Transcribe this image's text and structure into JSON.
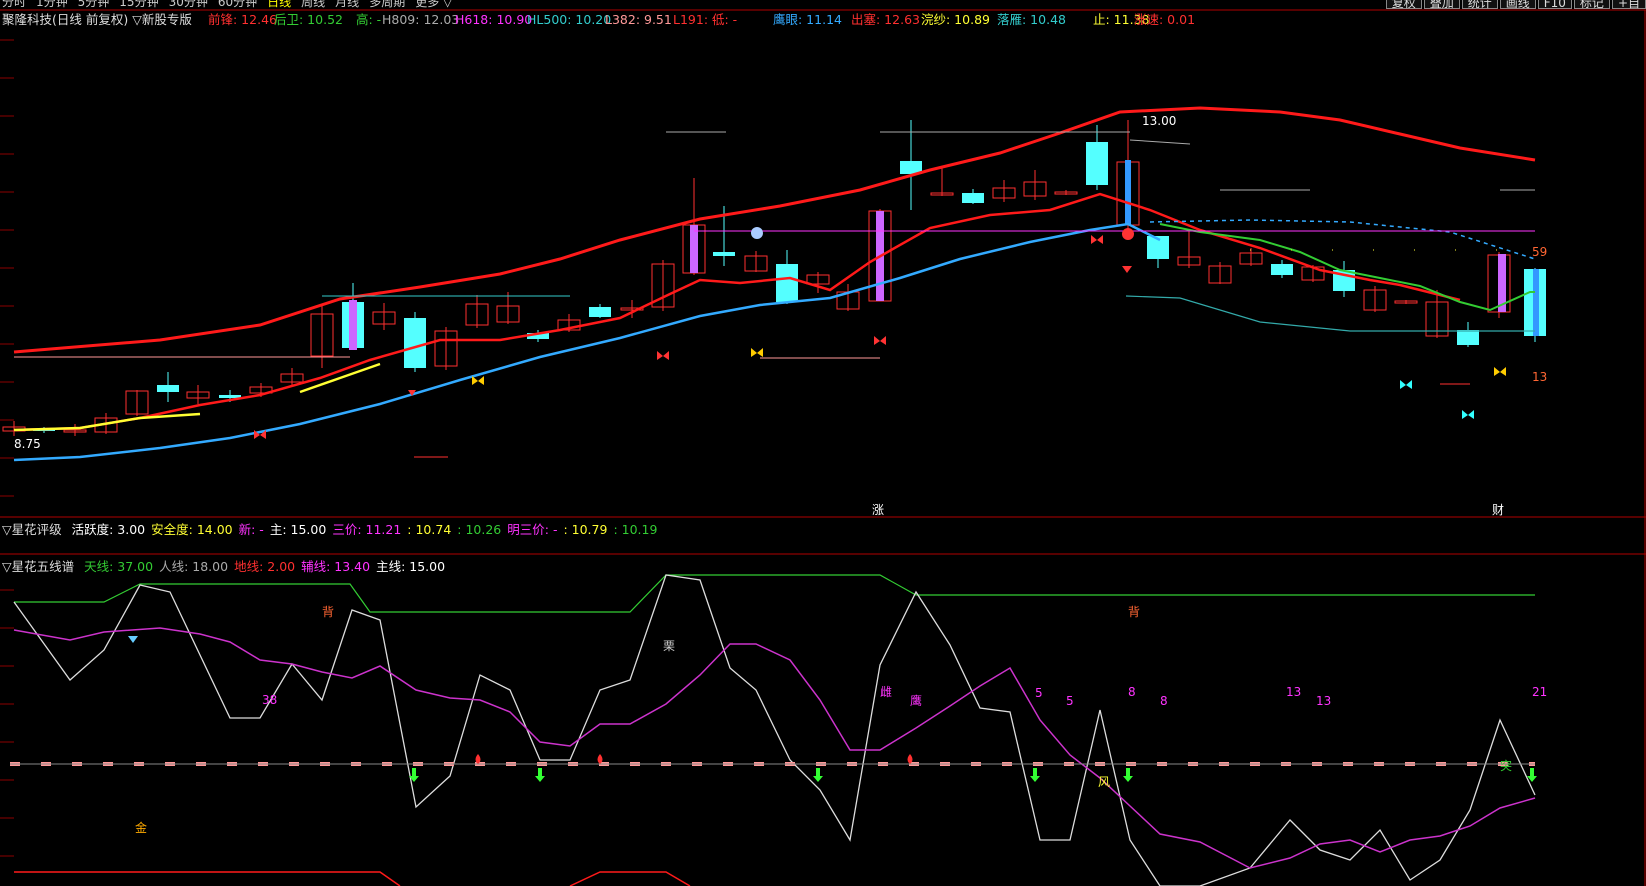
{
  "toolbar": {
    "periods": [
      "分时",
      "1分钟",
      "5分钟",
      "15分钟",
      "30分钟",
      "60分钟",
      "日线",
      "周线",
      "月线",
      "多周期",
      "更多 ▽"
    ],
    "active_period": "日线",
    "buttons": [
      "复权",
      "叠加",
      "统计",
      "画线",
      "F10",
      "标记",
      "+自"
    ]
  },
  "stock_title": "聚隆科技(日线 前复权) ▽新股专版",
  "main_indicators": [
    {
      "label": "前锋:",
      "value": "12.46",
      "color": "#ff3030"
    },
    {
      "label": "后卫:",
      "value": "10.52",
      "color": "#33cc33"
    },
    {
      "label": "高:",
      "value": "-",
      "color": "#33cc33"
    },
    {
      "label": "H809:",
      "value": "12.03",
      "color": "#aaaaaa"
    },
    {
      "label": "H618:",
      "value": "10.90",
      "color": "#ff33ff"
    },
    {
      "label": "HL500:",
      "value": "10.20",
      "color": "#33cccc"
    },
    {
      "label": "L382:",
      "value": "9.51",
      "color": "#ff9999"
    },
    {
      "label": "L191:",
      "value": "-",
      "color": "#ff3030"
    },
    {
      "label": "低:",
      "value": "-",
      "color": "#ff3030"
    },
    {
      "label": "鹰眼:",
      "value": "11.14",
      "color": "#33aaff"
    },
    {
      "label": "出塞:",
      "value": "12.63",
      "color": "#ff3030"
    },
    {
      "label": "浣纱:",
      "value": "10.89",
      "color": "#ffff33"
    },
    {
      "label": "落雁:",
      "value": "10.48",
      "color": "#33cccc"
    },
    {
      "label": "止:",
      "value": "11.38",
      "color": "#ffff33"
    },
    {
      "label": "涨速:",
      "value": "0.01",
      "color": "#ff3030"
    }
  ],
  "price_labels": {
    "high": "13.00",
    "low": "8.75",
    "right_top": "59",
    "right_bottom": "13"
  },
  "markers": {
    "zhang": "涨",
    "cai": "财"
  },
  "panel2": {
    "title": "▽星花评级",
    "items": [
      {
        "text": "活跃度: 3.00",
        "color": "#ffffff"
      },
      {
        "text": "安全度: 14.00",
        "color": "#ffff33"
      },
      {
        "text": "新: -",
        "color": "#ff33ff"
      },
      {
        "text": "主: 15.00",
        "color": "#ffffff"
      },
      {
        "text": "三价: 11.21",
        "color": "#ff33ff"
      },
      {
        "text": ": 10.74",
        "color": "#ffff33"
      },
      {
        "text": ": 10.26",
        "color": "#33cc33"
      },
      {
        "text": "明三价: -",
        "color": "#ff33ff"
      },
      {
        "text": ": 10.79",
        "color": "#ffff33"
      },
      {
        "text": ": 10.19",
        "color": "#33cc33"
      }
    ]
  },
  "panel3": {
    "title": "▽星花五线谱",
    "items": [
      {
        "text": "天线: 37.00",
        "color": "#33cc33"
      },
      {
        "text": "人线: 18.00",
        "color": "#aaaaaa"
      },
      {
        "text": "地线: 2.00",
        "color": "#ff3030"
      },
      {
        "text": "辅线: 13.40",
        "color": "#ff33ff"
      },
      {
        "text": "主线: 15.00",
        "color": "#ffffff"
      }
    ],
    "labels": [
      {
        "t": "背",
        "c": "#ff6633"
      },
      {
        "t": "背",
        "c": "#ff6633"
      },
      {
        "t": "栗",
        "c": "#cccccc"
      },
      {
        "t": "金",
        "c": "#ffaa00"
      },
      {
        "t": "风",
        "c": "#ffff33"
      },
      {
        "t": "突",
        "c": "#33cc33"
      },
      {
        "t": "雌",
        "c": "#ff33ff"
      },
      {
        "t": "鹰",
        "c": "#ff33ff"
      },
      {
        "t": "38",
        "c": "#ff33ff"
      },
      {
        "t": "5",
        "c": "#ff33ff"
      },
      {
        "t": "5",
        "c": "#ff33ff"
      },
      {
        "t": "8",
        "c": "#ff33ff"
      },
      {
        "t": "8",
        "c": "#ff33ff"
      },
      {
        "t": "13",
        "c": "#ff33ff"
      },
      {
        "t": "13",
        "c": "#ff33ff"
      },
      {
        "t": "21",
        "c": "#ff33ff"
      }
    ]
  },
  "colors": {
    "up": "#ff3030",
    "down": "#54ffff",
    "grid": "#8b0000",
    "ma_red": "#ff1a1a",
    "ma_blue": "#33aaff"
  }
}
